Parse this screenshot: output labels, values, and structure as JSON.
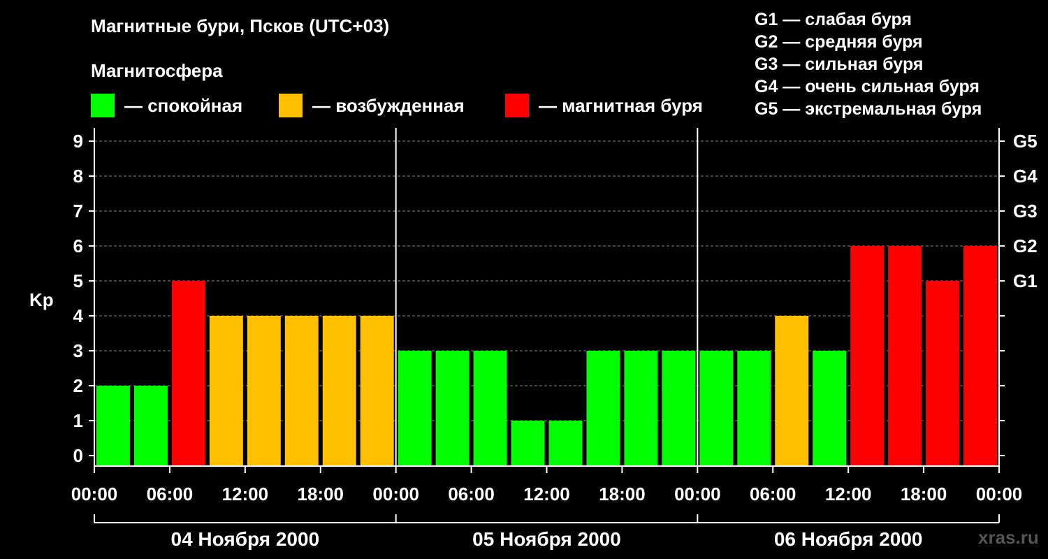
{
  "title": "Магнитные бури, Псков (UTC+03)",
  "magnetosphere_label": "Магнитосфера",
  "legend": [
    {
      "label": "— спокойная",
      "color": "#00ff00"
    },
    {
      "label": "— возбужденная",
      "color": "#ffc000"
    },
    {
      "label": "— магнитная буря",
      "color": "#ff0000"
    }
  ],
  "g_levels": [
    "G1 — слабая буря",
    "G2 — средняя буря",
    "G3 — сильная буря",
    "G4 — очень сильная буря",
    "G5 — экстремальная буря"
  ],
  "watermark": "xras.ru",
  "chart_data": {
    "type": "bar",
    "ylabel": "Kp",
    "ylim": [
      0,
      9
    ],
    "yticks": [
      0,
      1,
      2,
      3,
      4,
      5,
      6,
      7,
      8,
      9
    ],
    "right_ticks": [
      {
        "value": 5,
        "label": "G1"
      },
      {
        "value": 6,
        "label": "G2"
      },
      {
        "value": 7,
        "label": "G3"
      },
      {
        "value": 8,
        "label": "G4"
      },
      {
        "value": 9,
        "label": "G5"
      }
    ],
    "grid": true,
    "xtick_labels": [
      "00:00",
      "06:00",
      "12:00",
      "18:00",
      "00:00",
      "06:00",
      "12:00",
      "18:00",
      "00:00",
      "06:00",
      "12:00",
      "18:00",
      "00:00"
    ],
    "days": [
      "04 Ноября 2000",
      "05 Ноября 2000",
      "06 Ноября 2000"
    ],
    "values": [
      2,
      2,
      5,
      4,
      4,
      4,
      4,
      4,
      3,
      3,
      3,
      1,
      1,
      3,
      3,
      3,
      3,
      3,
      4,
      3,
      6,
      6,
      5,
      6
    ],
    "colors": {
      "quiet": "#00ff00",
      "excited": "#ffc000",
      "storm": "#ff0000"
    }
  }
}
